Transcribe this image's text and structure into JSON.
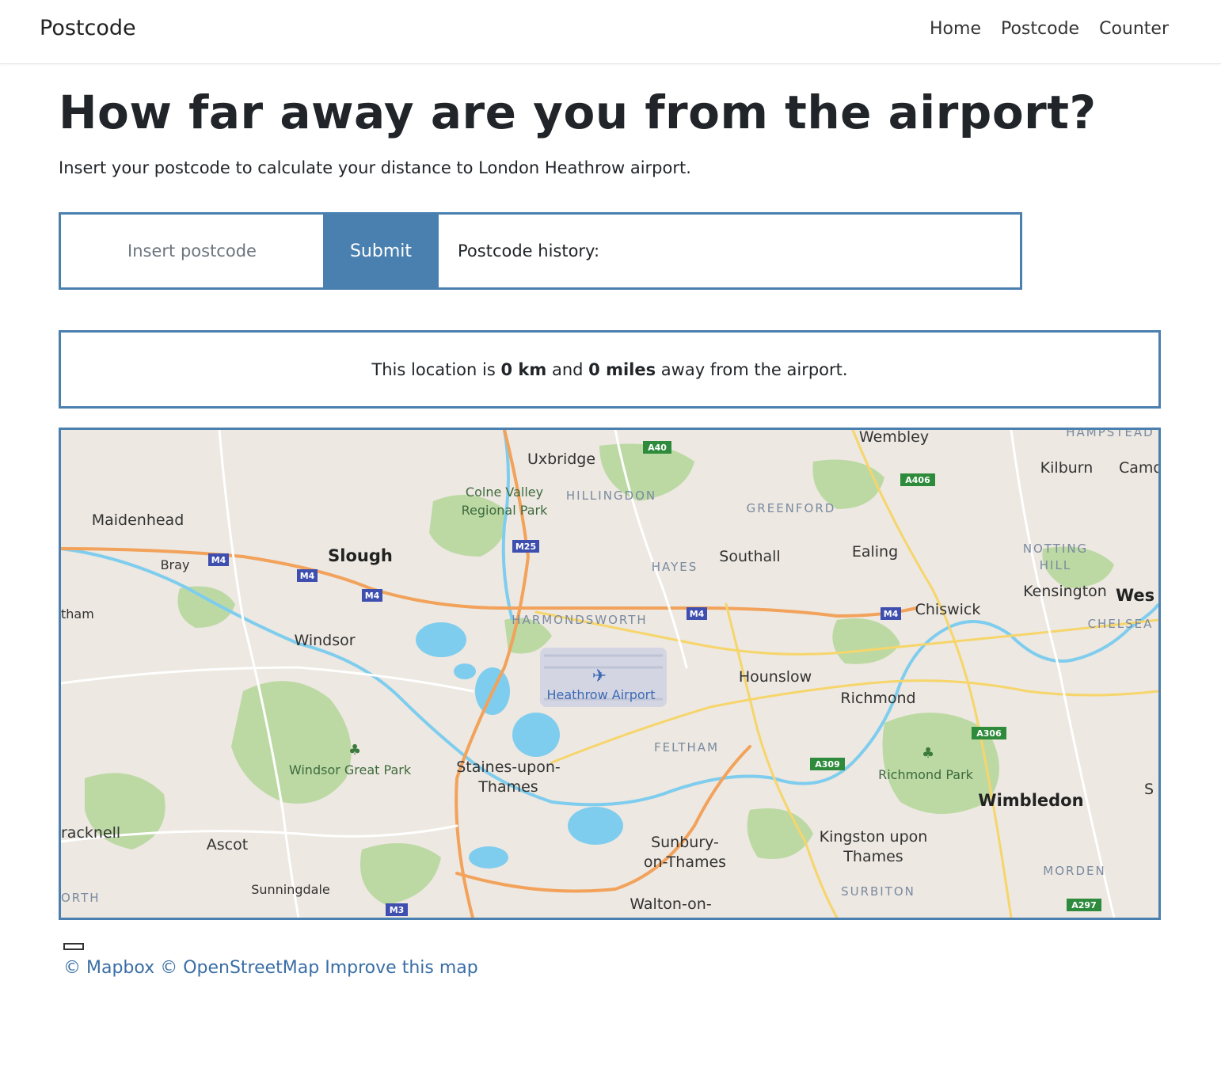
{
  "navbar": {
    "brand": "Postcode",
    "links": [
      "Home",
      "Postcode",
      "Counter"
    ]
  },
  "page": {
    "title": "How far away are you from the airport?",
    "subtitle": "Insert your postcode to calculate your distance to London Heathrow airport."
  },
  "form": {
    "input_placeholder": "Insert postcode",
    "input_value": "",
    "submit_label": "Submit",
    "history_label": "Postcode history:"
  },
  "result": {
    "prefix": "This location is",
    "km": "0 km",
    "and": "and",
    "miles": "0 miles",
    "suffix": "away from the airport."
  },
  "map": {
    "labels": {
      "wembley": "Wembley",
      "uxbridge": "Uxbridge",
      "colne_valley_1": "Colne Valley",
      "colne_valley_2": "Regional Park",
      "hillingdon": "HILLINGDON",
      "greenford": "GREENFORD",
      "kilburn": "Kilburn",
      "camden": "Camd",
      "hampstead": "HAMPSTEAD",
      "maidenhead": "Maidenhead",
      "bray": "Bray",
      "slough": "Slough",
      "hayes": "HAYES",
      "southall": "Southall",
      "ealing": "Ealing",
      "notting_1": "NOTTING",
      "notting_2": "HILL",
      "kensington": "Kensington",
      "west": "Wes",
      "chelsea": "CHELSEA",
      "eltham": "tham",
      "harmondsworth": "HARMONDSWORTH",
      "chiswick": "Chiswick",
      "windsor": "Windsor",
      "hounslow": "Hounslow",
      "heathrow": "Heathrow Airport",
      "richmond": "Richmond",
      "feltham": "FELTHAM",
      "windsor_great_park": "Windsor Great Park",
      "staines_1": "Staines-upon-",
      "staines_2": "Thames",
      "richmond_park": "Richmond Park",
      "wimbledon": "Wimbledon",
      "s_edge": "S",
      "bracknell": "racknell",
      "ascot": "Ascot",
      "sunbury_1": "Sunbury-",
      "sunbury_2": "on-Thames",
      "kingston_1": "Kingston upon",
      "kingston_2": "Thames",
      "morden": "MORDEN",
      "sunningdale": "Sunningdale",
      "surbiton": "SURBITON",
      "walton": "Walton-on-",
      "north": "ORTH"
    },
    "road_tags": {
      "a40": "A40",
      "a406": "A406",
      "m25": "M25",
      "m4_1": "M4",
      "m4_2": "M4",
      "m4_3": "M4",
      "m4_4": "M4",
      "m4_5": "M4",
      "m3": "M3",
      "a306": "A306",
      "a309": "A309",
      "a297": "A297"
    }
  },
  "attribution": {
    "mapbox": "© Mapbox",
    "osm": "© OpenStreetMap",
    "improve": "Improve this map"
  },
  "colors": {
    "accent": "#4a80b0",
    "link": "#3a6ea5"
  }
}
